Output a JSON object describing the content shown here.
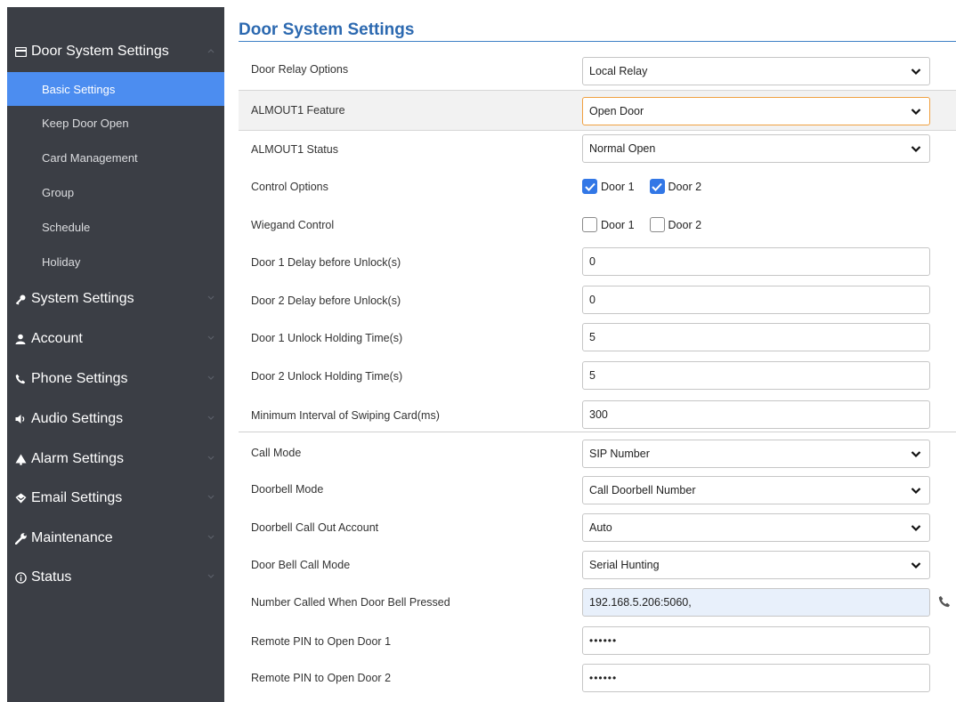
{
  "sidebar": {
    "groups": [
      {
        "label": "Door System Settings",
        "icon": "card-icon"
      },
      {
        "label": "System Settings",
        "icon": "key-icon"
      },
      {
        "label": "Account",
        "icon": "user-icon"
      },
      {
        "label": "Phone Settings",
        "icon": "phone-icon"
      },
      {
        "label": "Audio Settings",
        "icon": "speaker-icon"
      },
      {
        "label": "Alarm Settings",
        "icon": "bell-icon"
      },
      {
        "label": "Email Settings",
        "icon": "email-icon"
      },
      {
        "label": "Maintenance",
        "icon": "wrench-icon"
      },
      {
        "label": "Status",
        "icon": "info-icon"
      }
    ],
    "subitems": [
      {
        "label": "Basic Settings",
        "active": true
      },
      {
        "label": "Keep Door Open"
      },
      {
        "label": "Card Management"
      },
      {
        "label": "Group"
      },
      {
        "label": "Schedule"
      },
      {
        "label": "Holiday"
      }
    ]
  },
  "main": {
    "title": "Door System Settings",
    "fields": [
      {
        "label": "Door Relay Options",
        "value": "Local Relay"
      },
      {
        "label": "ALMOUT1 Feature",
        "value": "Open Door"
      },
      {
        "label": "ALMOUT1 Status",
        "value": "Normal Open"
      },
      {
        "label": "Control Options",
        "opt1": "Door 1",
        "opt2": "Door 2"
      },
      {
        "label": "Wiegand Control",
        "opt1": "Door 1",
        "opt2": "Door 2"
      },
      {
        "label": "Door 1 Delay before Unlock(s)",
        "value": "0"
      },
      {
        "label": "Door 2 Delay before Unlock(s)",
        "value": "0"
      },
      {
        "label": "Door 1 Unlock Holding Time(s)",
        "value": "5"
      },
      {
        "label": "Door 2 Unlock Holding Time(s)",
        "value": "5"
      },
      {
        "label": "Minimum Interval of Swiping Card(ms)",
        "value": "300"
      },
      {
        "label": "Call Mode",
        "value": "SIP Number"
      },
      {
        "label": "Doorbell Mode",
        "value": "Call Doorbell Number"
      },
      {
        "label": "Doorbell Call Out Account",
        "value": "Auto"
      },
      {
        "label": "Door Bell Call Mode",
        "value": "Serial Hunting"
      },
      {
        "label": "Number Called When Door Bell Pressed",
        "value": "192.168.5.206:5060,"
      },
      {
        "label": "Remote PIN to Open Door 1",
        "value": "••••••"
      },
      {
        "label": "Remote PIN to Open Door 2",
        "value": "••••••"
      }
    ],
    "checkbox_state": {
      "control_options": [
        true,
        true
      ],
      "wiegand_control": [
        false,
        false
      ]
    }
  },
  "colors": {
    "sidebar_bg": "#3b3e45",
    "active_item": "#4c8df0",
    "title_blue": "#2c69b0",
    "checkbox_on": "#3277e6",
    "focus_border": "#f0a040"
  }
}
